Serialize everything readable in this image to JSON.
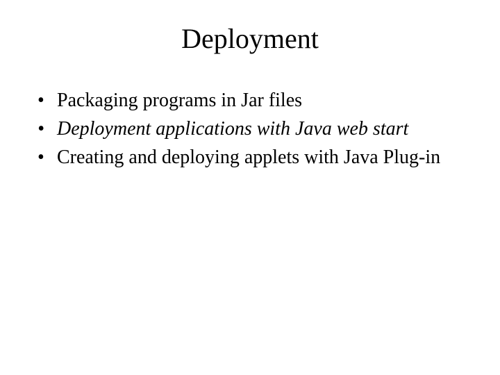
{
  "title": "Deployment",
  "bullets": [
    {
      "text": "Packaging programs in Jar files",
      "italic": false
    },
    {
      "text": "Deployment applications with Java web start",
      "italic": true
    },
    {
      "text": "Creating and deploying applets with Java Plug-in",
      "italic": false
    }
  ]
}
